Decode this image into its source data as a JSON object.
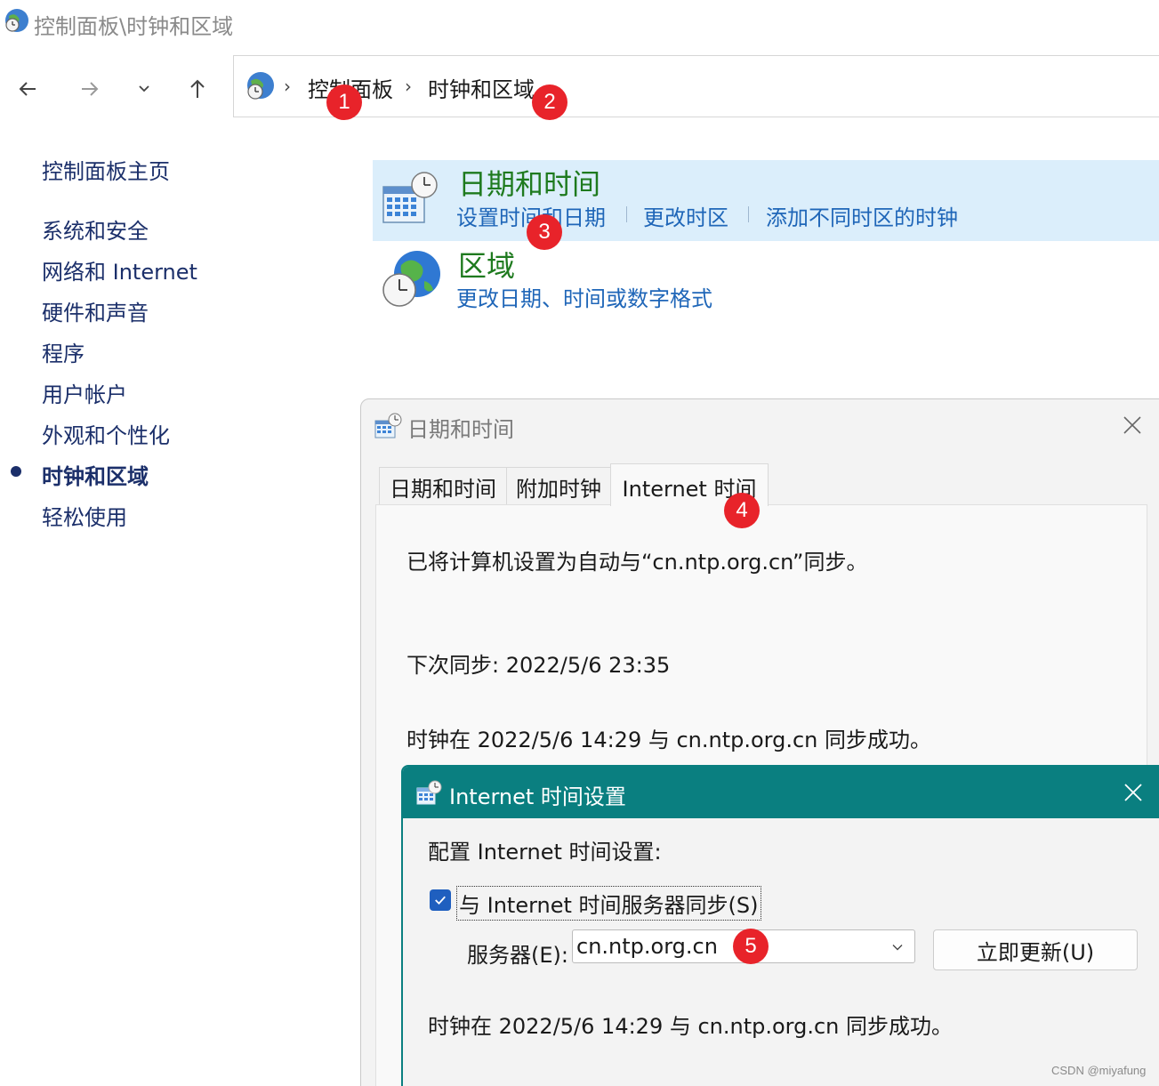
{
  "window": {
    "title": "控制面板\\时钟和区域"
  },
  "nav": {
    "back_icon": "arrow-left-icon",
    "forward_icon": "arrow-right-icon",
    "recent_icon": "chevron-down-icon",
    "up_icon": "arrow-up-icon"
  },
  "address_bar": {
    "icon": "control-panel-globe-icon",
    "crumbs": [
      "控制面板",
      "时钟和区域"
    ],
    "separator": "›"
  },
  "sidebar": {
    "items": [
      {
        "label": "控制面板主页",
        "active": false
      },
      {
        "label": "系统和安全",
        "active": false
      },
      {
        "label": "网络和 Internet",
        "active": false
      },
      {
        "label": "硬件和声音",
        "active": false
      },
      {
        "label": "程序",
        "active": false
      },
      {
        "label": "用户帐户",
        "active": false
      },
      {
        "label": "外观和个性化",
        "active": false
      },
      {
        "label": "时钟和区域",
        "active": true
      },
      {
        "label": "轻松使用",
        "active": false
      }
    ]
  },
  "categories": [
    {
      "title": "日期和时间",
      "icon": "calendar-clock-icon",
      "links": [
        "设置时间和日期",
        "更改时区",
        "添加不同时区的时钟"
      ]
    },
    {
      "title": "区域",
      "icon": "globe-clock-icon",
      "links": [
        "更改日期、时间或数字格式"
      ]
    }
  ],
  "datetime_dialog": {
    "title": "日期和时间",
    "tabs": [
      "日期和时间",
      "附加时钟",
      "Internet 时间"
    ],
    "active_tab": "Internet 时间",
    "status_line": "已将计算机设置为自动与“cn.ntp.org.cn”同步。",
    "next_sync": "下次同步: 2022/5/6 23:35",
    "last_sync": "时钟在 2022/5/6 14:29 与 cn.ntp.org.cn 同步成功。"
  },
  "internet_time_settings": {
    "title": "Internet 时间设置",
    "heading": "配置 Internet 时间设置:",
    "sync_checkbox_label": "与 Internet 时间服务器同步(S)",
    "sync_checked": true,
    "server_label": "服务器(E):",
    "server_value": "cn.ntp.org.cn",
    "update_button": "立即更新(U)",
    "result": "时钟在 2022/5/6 14:29 与 cn.ntp.org.cn 同步成功。"
  },
  "badges": [
    "1",
    "2",
    "3",
    "4",
    "5"
  ],
  "watermark": "CSDN @miyafung",
  "colors": {
    "accent_teal": "#0a7f80",
    "link_blue": "#1f66b8",
    "category_green": "#1e7a1e",
    "highlight_bg": "#dbeefb",
    "badge_red": "#e8232a"
  }
}
